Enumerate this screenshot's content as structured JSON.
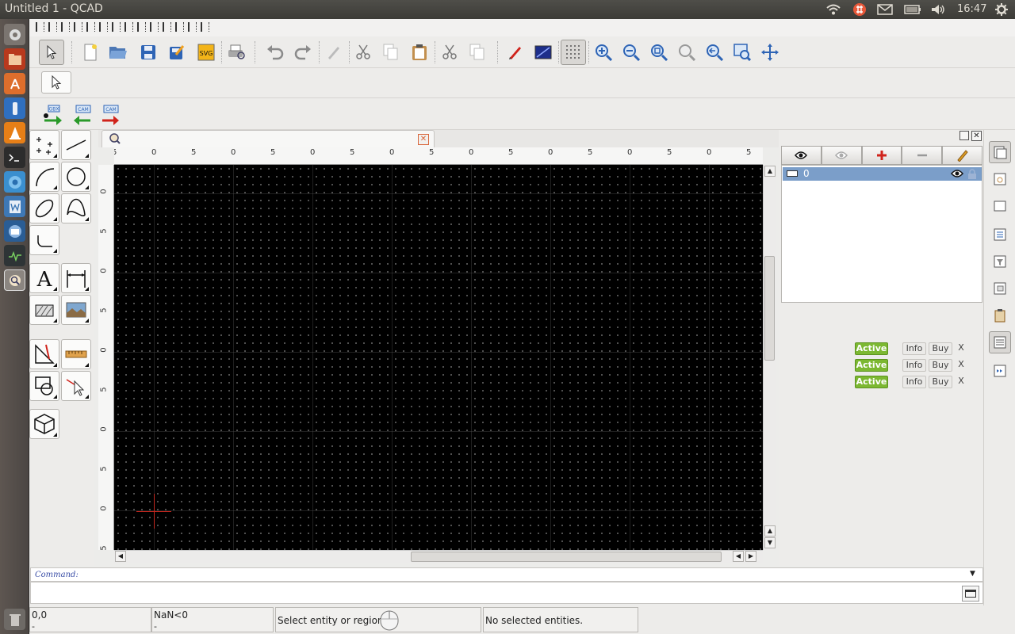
{
  "window": {
    "title": "Untitled 1 - QCAD"
  },
  "system": {
    "clock": "16:47"
  },
  "ruler": {
    "h_labels": [
      "5",
      "0",
      "5",
      "0",
      "5",
      "0",
      "5",
      "0",
      "5",
      "0",
      "5",
      "0",
      "5",
      "0",
      "5",
      "0",
      "5"
    ],
    "v_labels": [
      "0",
      "5",
      "0",
      "5",
      "0",
      "5",
      "0",
      "5",
      "0",
      "5"
    ]
  },
  "layers": {
    "items": [
      {
        "name": "0"
      }
    ]
  },
  "licenses": [
    {
      "status": "Active",
      "info": "Info",
      "buy": "Buy",
      "close": "X"
    },
    {
      "status": "Active",
      "info": "Info",
      "buy": "Buy",
      "close": "X"
    },
    {
      "status": "Active",
      "info": "Info",
      "buy": "Buy",
      "close": "X"
    }
  ],
  "command": {
    "label": "Command:",
    "value": ""
  },
  "status": {
    "abs_coord": "0,0",
    "abs_coord_sub": "-",
    "polar_coord": "NaN<0",
    "polar_coord_sub": "-",
    "mouse_hint": "Select entity or region",
    "selection": "No selected entities."
  },
  "colors": {
    "accent_active": "#7cb832",
    "layer_selection": "#7b9ec9",
    "crosshair": "#c2271e"
  }
}
